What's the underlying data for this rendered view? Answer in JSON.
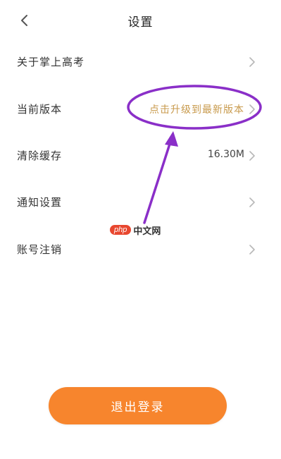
{
  "header": {
    "back_icon": "chevron-left-icon",
    "title": "设置"
  },
  "settings": [
    {
      "label": "关于掌上高考",
      "value": "",
      "chevron": "chevron-right-icon"
    },
    {
      "label": "当前版本",
      "value": "点击升级到最新版本",
      "chevron": "chevron-right-icon"
    },
    {
      "label": "清除缓存",
      "value": "16.30M",
      "chevron": "chevron-right-icon"
    },
    {
      "label": "通知设置",
      "value": "",
      "chevron": "chevron-right-icon"
    },
    {
      "label": "账号注销",
      "value": "",
      "chevron": "chevron-right-icon"
    }
  ],
  "watermark": {
    "logo": "php",
    "text": "中文网"
  },
  "logout": {
    "label": "退出登录"
  },
  "colors": {
    "accent_text": "#c89a4c",
    "button": "#f7852d",
    "annotation": "#8a2fc8",
    "watermark_logo": "#e8472f"
  }
}
